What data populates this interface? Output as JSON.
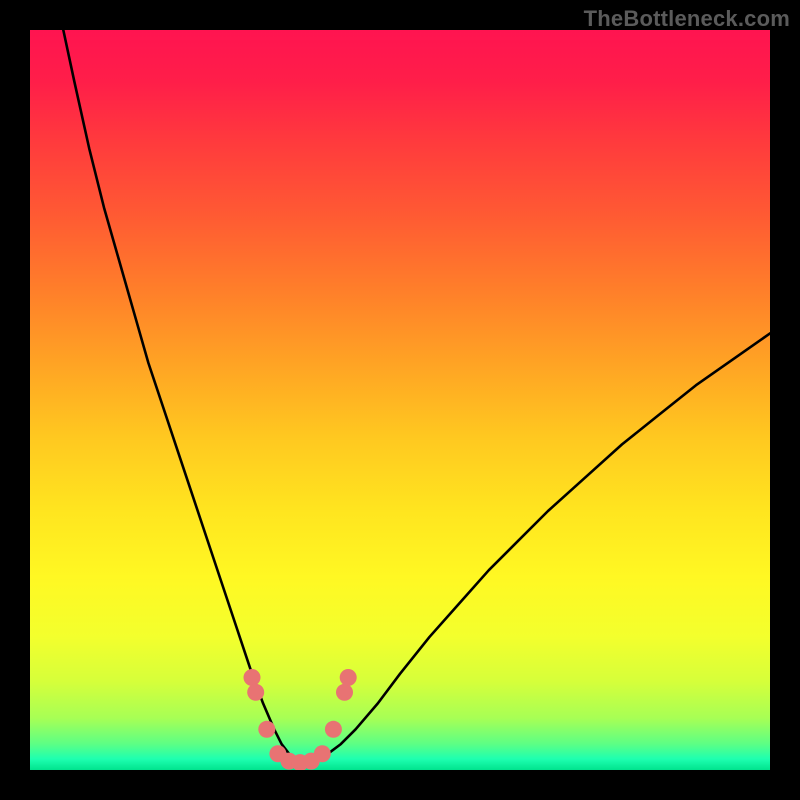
{
  "watermark": "TheBottleneck.com",
  "chart_data": {
    "type": "line",
    "title": "",
    "xlabel": "",
    "ylabel": "",
    "xlim": [
      0,
      100
    ],
    "ylim": [
      0,
      100
    ],
    "grid": false,
    "series": [
      {
        "name": "curve",
        "x": [
          4.5,
          6,
          8,
          10,
          12,
          14,
          16,
          18,
          20,
          22,
          24,
          26,
          28,
          30,
          31.5,
          33,
          34,
          35,
          36,
          37,
          38,
          40,
          42,
          44,
          47,
          50,
          54,
          58,
          62,
          66,
          70,
          75,
          80,
          85,
          90,
          95,
          100
        ],
        "y": [
          100,
          93,
          84,
          76,
          69,
          62,
          55,
          49,
          43,
          37,
          31,
          25,
          19,
          13,
          9,
          5.5,
          3.5,
          2.2,
          1.4,
          1.0,
          1.2,
          2.0,
          3.5,
          5.5,
          9,
          13,
          18,
          22.5,
          27,
          31,
          35,
          39.5,
          44,
          48,
          52,
          55.5,
          59
        ]
      }
    ],
    "markers": [
      {
        "x": 30,
        "y": 12.5
      },
      {
        "x": 30.5,
        "y": 10.5
      },
      {
        "x": 32,
        "y": 5.5
      },
      {
        "x": 33.5,
        "y": 2.2
      },
      {
        "x": 35,
        "y": 1.2
      },
      {
        "x": 36.5,
        "y": 1.0
      },
      {
        "x": 38,
        "y": 1.2
      },
      {
        "x": 39.5,
        "y": 2.2
      },
      {
        "x": 41,
        "y": 5.5
      },
      {
        "x": 42.5,
        "y": 10.5
      },
      {
        "x": 43,
        "y": 12.5
      }
    ],
    "gradient_stops": [
      {
        "offset": 0.0,
        "color": "#ff1450"
      },
      {
        "offset": 0.07,
        "color": "#ff1e49"
      },
      {
        "offset": 0.15,
        "color": "#ff3a3d"
      },
      {
        "offset": 0.25,
        "color": "#ff5a33"
      },
      {
        "offset": 0.35,
        "color": "#ff7e2a"
      },
      {
        "offset": 0.45,
        "color": "#ffa324"
      },
      {
        "offset": 0.55,
        "color": "#ffc820"
      },
      {
        "offset": 0.65,
        "color": "#ffe51f"
      },
      {
        "offset": 0.74,
        "color": "#fff823"
      },
      {
        "offset": 0.82,
        "color": "#f3ff2d"
      },
      {
        "offset": 0.88,
        "color": "#d6ff3a"
      },
      {
        "offset": 0.93,
        "color": "#a7ff55"
      },
      {
        "offset": 0.965,
        "color": "#5cff85"
      },
      {
        "offset": 0.985,
        "color": "#1effb0"
      },
      {
        "offset": 1.0,
        "color": "#00e38d"
      }
    ],
    "marker_color": "#e87373",
    "curve_color": "#000000"
  }
}
